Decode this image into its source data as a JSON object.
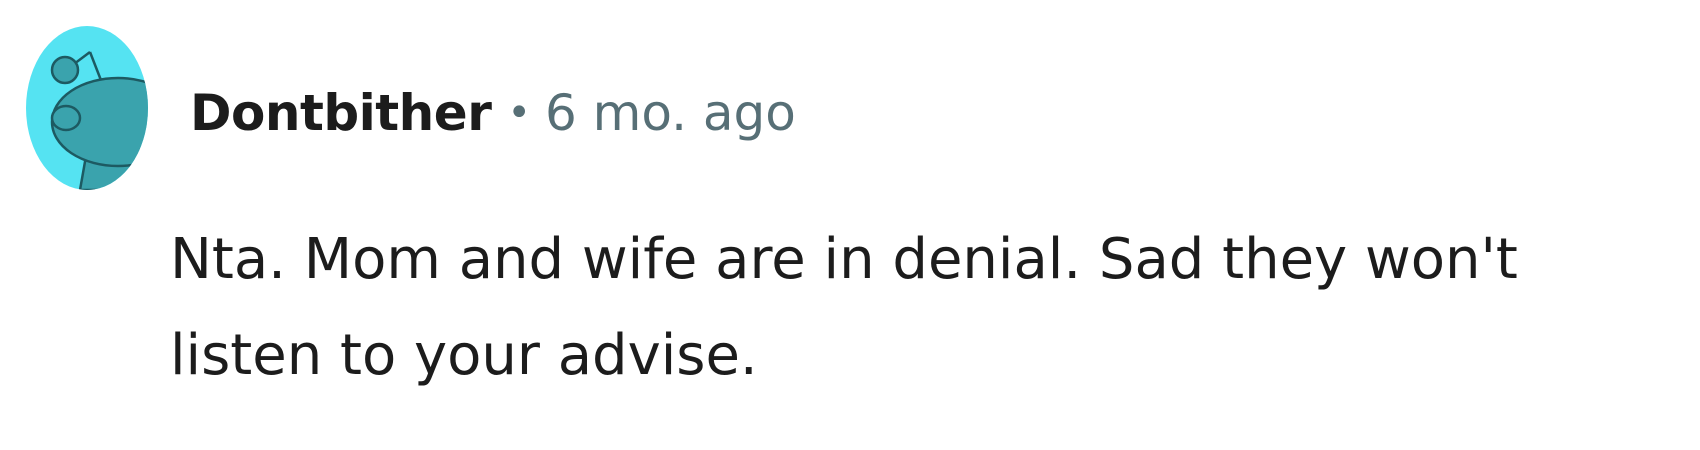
{
  "comment": {
    "author": "Dontbither",
    "separator": "•",
    "timestamp": "6 mo. ago",
    "body": "Nta. Mom and wife are in denial. Sad they won't listen to your advise.",
    "avatar": {
      "icon": "snoo-avatar-icon",
      "background_color": "#55e3f2",
      "figure_color": "#3aa3ad",
      "outline_color": "#1d5a62"
    }
  }
}
